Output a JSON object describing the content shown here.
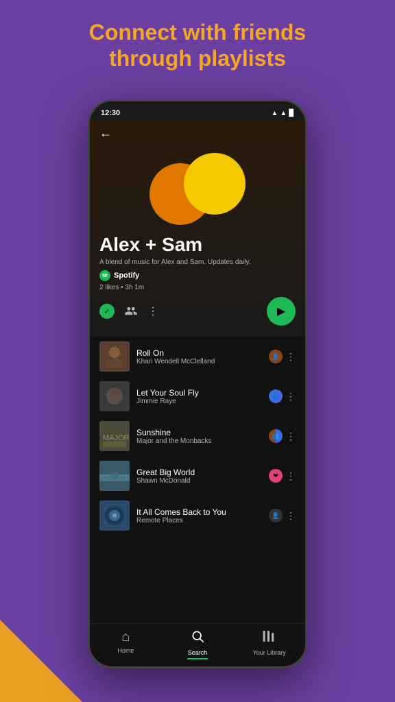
{
  "page": {
    "background_color": "#6b3fa0",
    "header": {
      "line1": "Connect with friends",
      "line2": "through playlists"
    }
  },
  "phone": {
    "status_bar": {
      "time": "12:30",
      "signal": "▲",
      "wifi": "▲",
      "battery": "▉"
    },
    "playlist": {
      "title": "Alex + Sam",
      "description": "A blend of music for Alex and Sam. Updates daily.",
      "brand": "Spotify",
      "stats": "2 likes • 3h 1m",
      "back_label": "←"
    },
    "tracks": [
      {
        "name": "Roll On",
        "artist": "Khari Wendell McClelland",
        "thumb_class": "thumb-roll",
        "av_class": "av-brown"
      },
      {
        "name": "Let Your Soul Fly",
        "artist": "Jimmie Raye",
        "thumb_class": "thumb-soul",
        "av_class": "av-blue"
      },
      {
        "name": "Sunshine",
        "artist": "Major and the Monbacks",
        "thumb_class": "thumb-sunshine",
        "av_class": "av-multi"
      },
      {
        "name": "Great Big World",
        "artist": "Shawn McDonald",
        "thumb_class": "thumb-world",
        "av_class": "av-pink"
      },
      {
        "name": "It All Comes Back to You",
        "artist": "Remote Places",
        "thumb_class": "thumb-remote",
        "av_class": "av-dark"
      }
    ],
    "bottom_nav": [
      {
        "label": "Home",
        "icon": "⌂",
        "active": false,
        "id": "home"
      },
      {
        "label": "Search",
        "icon": "⌕",
        "active": true,
        "id": "search"
      },
      {
        "label": "Your Library",
        "icon": "|||",
        "active": false,
        "id": "library"
      }
    ]
  }
}
